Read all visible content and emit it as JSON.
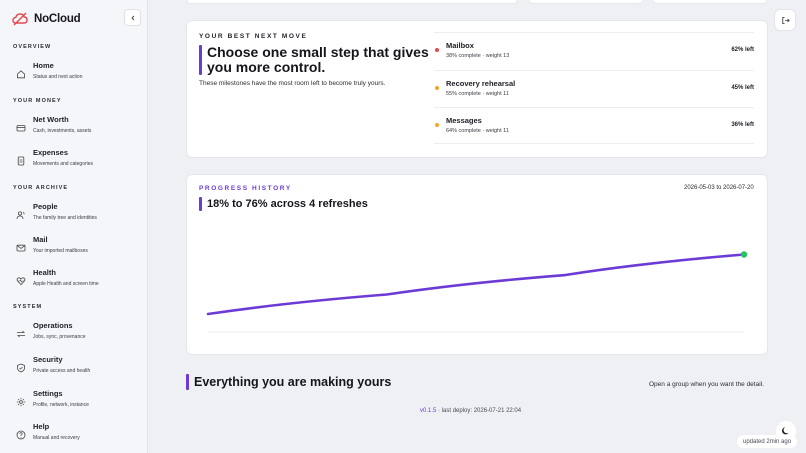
{
  "brand": {
    "name": "NoCloud"
  },
  "sidebar": {
    "sections": [
      {
        "label": "OVERVIEW"
      },
      {
        "label": "YOUR MONEY"
      },
      {
        "label": "YOUR ARCHIVE"
      },
      {
        "label": "SYSTEM"
      }
    ],
    "items": [
      {
        "title": "Home",
        "subtitle": "Status and next action",
        "icon": "home-icon"
      },
      {
        "title": "Net Worth",
        "subtitle": "Cash, investments, assets",
        "icon": "wallet-icon"
      },
      {
        "title": "Expenses",
        "subtitle": "Movements and categories",
        "icon": "receipt-icon"
      },
      {
        "title": "People",
        "subtitle": "The family tree and identities",
        "icon": "people-icon"
      },
      {
        "title": "Mail",
        "subtitle": "Your imported mailboxes",
        "icon": "mail-icon"
      },
      {
        "title": "Health",
        "subtitle": "Apple Health and screen time",
        "icon": "heart-icon"
      },
      {
        "title": "Operations",
        "subtitle": "Jobs, sync, provenance",
        "icon": "operations-icon"
      },
      {
        "title": "Security",
        "subtitle": "Private access and health",
        "icon": "shield-icon"
      },
      {
        "title": "Settings",
        "subtitle": "Profile, network, instance",
        "icon": "settings-icon"
      },
      {
        "title": "Help",
        "subtitle": "Manual and recovery",
        "icon": "help-icon"
      }
    ]
  },
  "next_move": {
    "eyebrow": "YOUR BEST NEXT MOVE",
    "headline_line1": "Choose one small step that gives",
    "headline_line2": "you more control.",
    "body": "These milestones have the most room left to become truly yours.",
    "milestones": [
      {
        "title": "Mailbox",
        "subtitle": "38% complete · weight 13",
        "left": "62% left",
        "color": "#e5484d"
      },
      {
        "title": "Recovery rehearsal",
        "subtitle": "55% complete · weight 11",
        "left": "45% left",
        "color": "#f5a524"
      },
      {
        "title": "Messages",
        "subtitle": "64% complete · weight 11",
        "left": "36% left",
        "color": "#f5a524"
      }
    ]
  },
  "history": {
    "eyebrow": "PROGRESS HISTORY",
    "date_range": "2026-05-03 to 2026-07-20",
    "headline": "18% to 76% across 4 refreshes"
  },
  "chart_data": {
    "type": "line",
    "series": [
      {
        "values": [
          18,
          37,
          56,
          76
        ],
        "color": "#6c3bd6"
      }
    ],
    "ylim": [
      0,
      100
    ],
    "grid": false,
    "end_marker_color": "#22c55e"
  },
  "footer": {
    "headline": "Everything you are making yours",
    "hint": "Open a group when you want the detail.",
    "version": "v0.1.5",
    "deploy": "· last deploy: 2026-07-21 22:04",
    "updated": "updated 2min ago"
  },
  "colors": {
    "accent": "#6c3bd6",
    "brand_red": "#e5484d"
  }
}
